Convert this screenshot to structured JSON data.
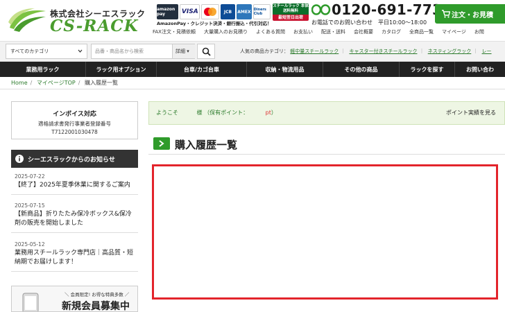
{
  "header": {
    "company_name": "株式会社シーエスラック",
    "brand_name": "CS-RACK",
    "payment_logos": [
      "amazon pay",
      "VISA",
      "mastercard",
      "JCB",
      "AMEX",
      "Diners Club"
    ],
    "payment_line": "AmazonPay・クレジット決済・銀行振込・代引対応！",
    "badge_top": "スチールラック 本体送料無料",
    "badge_bottom": "最短翌日出荷",
    "phone_number": "0120-691-773",
    "phone_sub1": "お電話でのお問い合わせ",
    "phone_sub2": "平日10:00～18:00",
    "cart_label": "注文・お見積",
    "subnav": [
      "FAX注文・見積依頼",
      "大量購入のお見積り",
      "よくある質問",
      "お支払い",
      "配送・送料",
      "会社概要",
      "カタログ",
      "全商品一覧",
      "マイページ",
      "お問"
    ]
  },
  "search": {
    "category_label": "すべてのカテゴリ",
    "placeholder": "品番・商品名から検索",
    "detail_label": "詳細",
    "popular_label": "人気の商品カテゴリ：",
    "popular_links": [
      "軽中量スチールラック",
      "キャスター付きスチールラック",
      "ネスティングラック",
      "レー"
    ]
  },
  "mainnav": [
    "業務用ラック",
    "ラック用オプション",
    "台車/カゴ台車",
    "収納・物流用品",
    "その他の商品",
    "ラックを探す",
    "お問い合わ"
  ],
  "breadcrumb": [
    "Home",
    "マイページTOP",
    "購入履歴一覧"
  ],
  "sidebar": {
    "invoice_title": "インボイス対応",
    "invoice_line1": "適格請求書発行事業者登録番号",
    "invoice_line2": "T7122001030478",
    "notice_title": "シーエスラックからのお知らせ",
    "news": [
      {
        "date": "2025-07-22",
        "title": "【終了】2025年夏季休業に関するご案内"
      },
      {
        "date": "2025-07-15",
        "title": "【新商品】折りたたみ保冷ボックス&保冷剤の販売を開始しました"
      },
      {
        "date": "2025-05-12",
        "title": "業務用スチールラック専門店｜高品質・短納期でお届けします！"
      }
    ],
    "banner_sub": "＼ 会員限定! お得な特典多数 ／",
    "banner_main": "新規会員募集中"
  },
  "content": {
    "welcome_prefix": "ようこそ",
    "welcome_mid": "様 （保有ポイント：",
    "welcome_pt": "pt",
    "welcome_suffix": "）",
    "points_link": "ポイント実績を見る",
    "page_title": "購入履歴一覧"
  },
  "colors": {
    "brand_green": "#2f9b2b",
    "nav_dark": "#222222",
    "highlight_red": "#e3242b"
  }
}
